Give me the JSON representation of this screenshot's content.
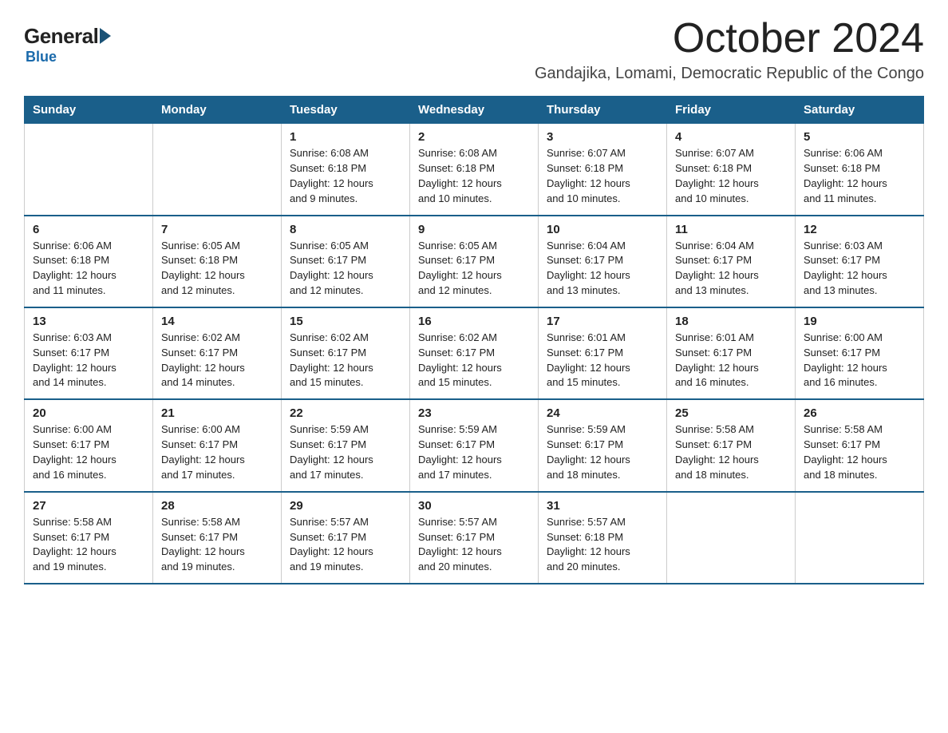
{
  "header": {
    "logo": {
      "general": "General",
      "blue": "Blue"
    },
    "title": "October 2024",
    "location": "Gandajika, Lomami, Democratic Republic of the Congo"
  },
  "weekdays": [
    "Sunday",
    "Monday",
    "Tuesday",
    "Wednesday",
    "Thursday",
    "Friday",
    "Saturday"
  ],
  "weeks": [
    [
      {
        "day": "",
        "info": ""
      },
      {
        "day": "",
        "info": ""
      },
      {
        "day": "1",
        "info": "Sunrise: 6:08 AM\nSunset: 6:18 PM\nDaylight: 12 hours\nand 9 minutes."
      },
      {
        "day": "2",
        "info": "Sunrise: 6:08 AM\nSunset: 6:18 PM\nDaylight: 12 hours\nand 10 minutes."
      },
      {
        "day": "3",
        "info": "Sunrise: 6:07 AM\nSunset: 6:18 PM\nDaylight: 12 hours\nand 10 minutes."
      },
      {
        "day": "4",
        "info": "Sunrise: 6:07 AM\nSunset: 6:18 PM\nDaylight: 12 hours\nand 10 minutes."
      },
      {
        "day": "5",
        "info": "Sunrise: 6:06 AM\nSunset: 6:18 PM\nDaylight: 12 hours\nand 11 minutes."
      }
    ],
    [
      {
        "day": "6",
        "info": "Sunrise: 6:06 AM\nSunset: 6:18 PM\nDaylight: 12 hours\nand 11 minutes."
      },
      {
        "day": "7",
        "info": "Sunrise: 6:05 AM\nSunset: 6:18 PM\nDaylight: 12 hours\nand 12 minutes."
      },
      {
        "day": "8",
        "info": "Sunrise: 6:05 AM\nSunset: 6:17 PM\nDaylight: 12 hours\nand 12 minutes."
      },
      {
        "day": "9",
        "info": "Sunrise: 6:05 AM\nSunset: 6:17 PM\nDaylight: 12 hours\nand 12 minutes."
      },
      {
        "day": "10",
        "info": "Sunrise: 6:04 AM\nSunset: 6:17 PM\nDaylight: 12 hours\nand 13 minutes."
      },
      {
        "day": "11",
        "info": "Sunrise: 6:04 AM\nSunset: 6:17 PM\nDaylight: 12 hours\nand 13 minutes."
      },
      {
        "day": "12",
        "info": "Sunrise: 6:03 AM\nSunset: 6:17 PM\nDaylight: 12 hours\nand 13 minutes."
      }
    ],
    [
      {
        "day": "13",
        "info": "Sunrise: 6:03 AM\nSunset: 6:17 PM\nDaylight: 12 hours\nand 14 minutes."
      },
      {
        "day": "14",
        "info": "Sunrise: 6:02 AM\nSunset: 6:17 PM\nDaylight: 12 hours\nand 14 minutes."
      },
      {
        "day": "15",
        "info": "Sunrise: 6:02 AM\nSunset: 6:17 PM\nDaylight: 12 hours\nand 15 minutes."
      },
      {
        "day": "16",
        "info": "Sunrise: 6:02 AM\nSunset: 6:17 PM\nDaylight: 12 hours\nand 15 minutes."
      },
      {
        "day": "17",
        "info": "Sunrise: 6:01 AM\nSunset: 6:17 PM\nDaylight: 12 hours\nand 15 minutes."
      },
      {
        "day": "18",
        "info": "Sunrise: 6:01 AM\nSunset: 6:17 PM\nDaylight: 12 hours\nand 16 minutes."
      },
      {
        "day": "19",
        "info": "Sunrise: 6:00 AM\nSunset: 6:17 PM\nDaylight: 12 hours\nand 16 minutes."
      }
    ],
    [
      {
        "day": "20",
        "info": "Sunrise: 6:00 AM\nSunset: 6:17 PM\nDaylight: 12 hours\nand 16 minutes."
      },
      {
        "day": "21",
        "info": "Sunrise: 6:00 AM\nSunset: 6:17 PM\nDaylight: 12 hours\nand 17 minutes."
      },
      {
        "day": "22",
        "info": "Sunrise: 5:59 AM\nSunset: 6:17 PM\nDaylight: 12 hours\nand 17 minutes."
      },
      {
        "day": "23",
        "info": "Sunrise: 5:59 AM\nSunset: 6:17 PM\nDaylight: 12 hours\nand 17 minutes."
      },
      {
        "day": "24",
        "info": "Sunrise: 5:59 AM\nSunset: 6:17 PM\nDaylight: 12 hours\nand 18 minutes."
      },
      {
        "day": "25",
        "info": "Sunrise: 5:58 AM\nSunset: 6:17 PM\nDaylight: 12 hours\nand 18 minutes."
      },
      {
        "day": "26",
        "info": "Sunrise: 5:58 AM\nSunset: 6:17 PM\nDaylight: 12 hours\nand 18 minutes."
      }
    ],
    [
      {
        "day": "27",
        "info": "Sunrise: 5:58 AM\nSunset: 6:17 PM\nDaylight: 12 hours\nand 19 minutes."
      },
      {
        "day": "28",
        "info": "Sunrise: 5:58 AM\nSunset: 6:17 PM\nDaylight: 12 hours\nand 19 minutes."
      },
      {
        "day": "29",
        "info": "Sunrise: 5:57 AM\nSunset: 6:17 PM\nDaylight: 12 hours\nand 19 minutes."
      },
      {
        "day": "30",
        "info": "Sunrise: 5:57 AM\nSunset: 6:17 PM\nDaylight: 12 hours\nand 20 minutes."
      },
      {
        "day": "31",
        "info": "Sunrise: 5:57 AM\nSunset: 6:18 PM\nDaylight: 12 hours\nand 20 minutes."
      },
      {
        "day": "",
        "info": ""
      },
      {
        "day": "",
        "info": ""
      }
    ]
  ]
}
